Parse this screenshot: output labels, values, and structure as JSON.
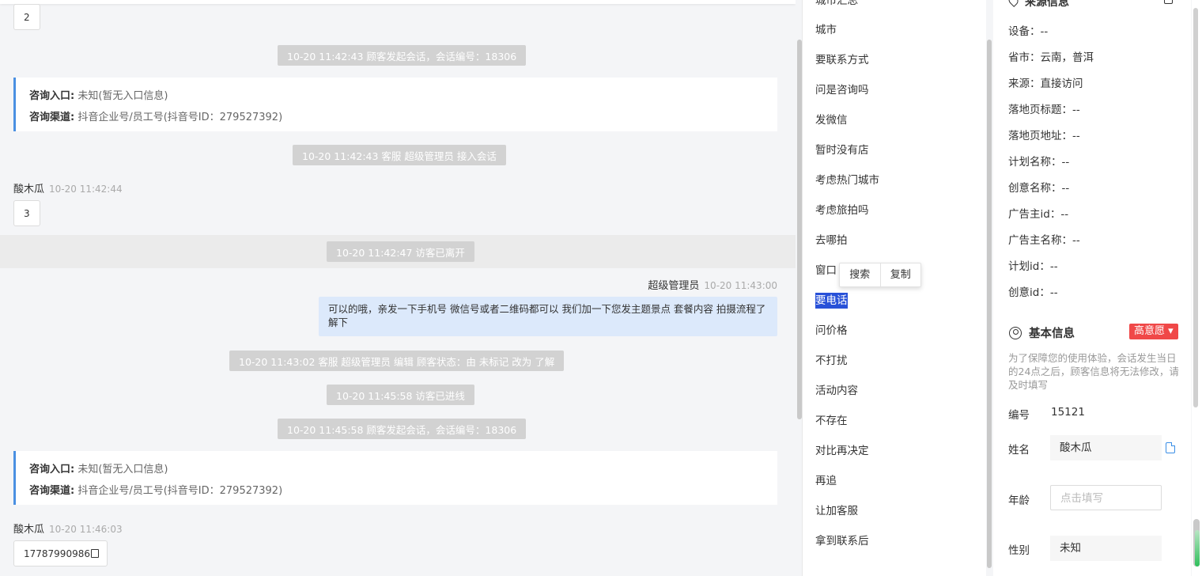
{
  "chat": {
    "msg_top_value": "2",
    "sys_session_1": "10-20 11:42:43 顾客发起会话，会话编号：18306",
    "card_1": {
      "entry_label": "咨询入口:",
      "entry_value": "未知(暂无入口信息)",
      "channel_label": "咨询渠道:",
      "channel_value": "抖音企业号/员工号(抖音号ID：279527392)"
    },
    "sys_agent_join": "10-20 11:42:43 客服 超级管理员 接入会话",
    "visitor_1": {
      "name": "酸木瓜",
      "time": "10-20 11:42:44",
      "message": "3"
    },
    "sys_left": "10-20 11:42:47 访客已离开",
    "agent": {
      "name": "超级管理员",
      "time": "10-20 11:43:00",
      "message": "可以的哦，亲发一下手机号 微信号或者二维码都可以 我们加一下您发主题景点 套餐内容 拍摄流程了解下"
    },
    "sys_status_edit": "10-20 11:43:02 客服 超级管理员 编辑 顾客状态：由 未标记 改为 了解",
    "sys_online": "10-20 11:45:58 访客已进线",
    "sys_session_2": "10-20 11:45:58 顾客发起会话，会话编号：18306",
    "card_2": {
      "entry_label": "咨询入口:",
      "entry_value": "未知(暂无入口信息)",
      "channel_label": "咨询渠道:",
      "channel_value": "抖音企业号/员工号(抖音号ID：279527392)"
    },
    "visitor_2": {
      "name": "酸木瓜",
      "time": "10-20 11:46:03",
      "message": "17787990986"
    }
  },
  "tags": {
    "items": [
      "城市汇总",
      "城市",
      "要联系方式",
      "问是咨询吗",
      "发微信",
      "暂时没有店",
      "考虑热门城市",
      "考虑旅拍吗",
      "去哪拍",
      "窗口期",
      "要电话",
      "问价格",
      "不打扰",
      "活动内容",
      "不存在",
      "对比再决定",
      "再追",
      "让加客服",
      "拿到联系后"
    ],
    "selected": "要电话",
    "window_partial": "窗口"
  },
  "context_menu": {
    "search": "搜索",
    "copy": "复制"
  },
  "source": {
    "title": "来源信息",
    "rows": [
      "设备：--",
      "省市：云南，普洱",
      "来源：直接访问",
      "落地页标题：--",
      "落地页地址：--",
      "计划名称：--",
      "创意名称：--",
      "广告主id：--",
      "广告主名称：--",
      "计划id：--",
      "创意id：--"
    ]
  },
  "basic": {
    "title": "基本信息",
    "intent_badge": "高意愿 ▾",
    "notice": "为了保障您的使用体验，会话发生当日的24点之后，顾客信息将无法修改，请及时填写",
    "id_label": "编号",
    "id_value": "15121",
    "name_label": "姓名",
    "name_value": "酸木瓜",
    "age_label": "年龄",
    "age_placeholder": "点击填写",
    "gender_label": "性别",
    "gender_value": "未知"
  },
  "colors": {
    "accent_blue": "#4a90e2",
    "selected_tag": "#2851d8",
    "intent_red": "#f04848",
    "agent_bubble": "#dce9fb"
  }
}
